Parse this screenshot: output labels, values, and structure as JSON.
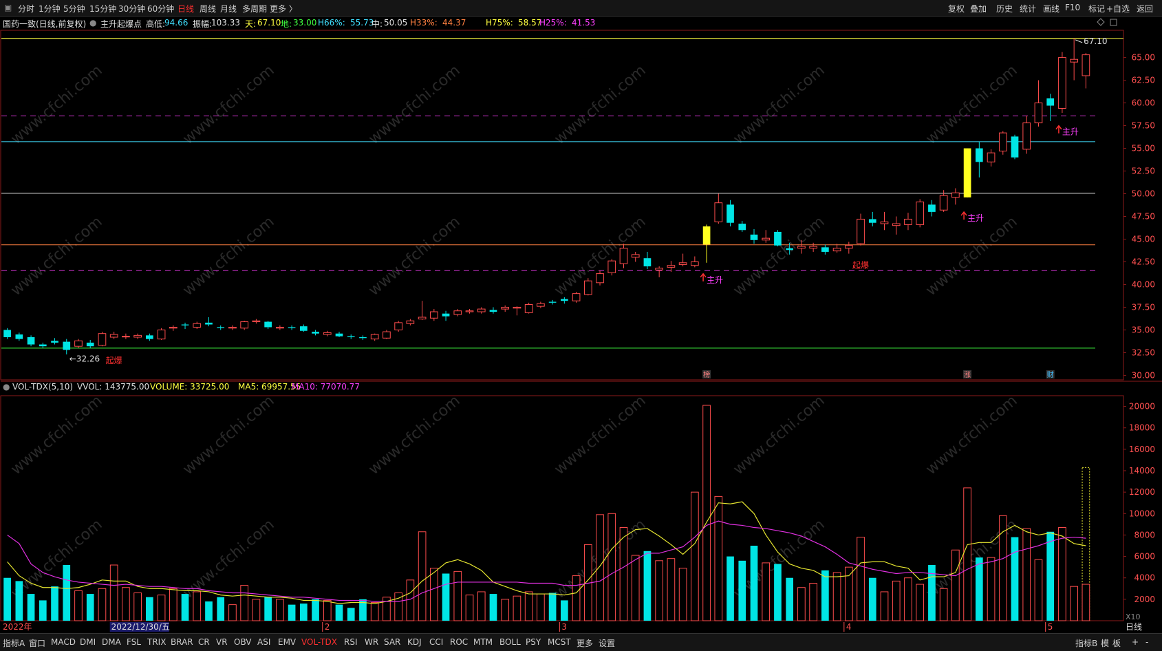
{
  "topbar": {
    "periods": [
      "分时",
      "1分钟",
      "5分钟",
      "15分钟",
      "30分钟",
      "60分钟",
      "日线",
      "周线",
      "月线",
      "多周期",
      "更多 〉"
    ],
    "active_period": "日线",
    "right_buttons": [
      "复权",
      "叠加",
      "历史",
      "统计",
      "画线",
      "F10",
      "标记",
      "+自选",
      "返回"
    ]
  },
  "infobar": {
    "stock": "国药一致(日线,前复权)",
    "indicator": "主升起爆点",
    "items": [
      {
        "label": "高低:",
        "value": "94.66",
        "color": "#e0e0e0",
        "vcolor": "#40e0ff"
      },
      {
        "label": "振幅:",
        "value": "103.33",
        "color": "#e0e0e0",
        "vcolor": "#e0e0e0"
      },
      {
        "label": "天:",
        "value": "67.10",
        "color": "#ffff40",
        "vcolor": "#ffff40"
      },
      {
        "label": "地:",
        "value": "33.00",
        "color": "#40ff40",
        "vcolor": "#40ff40"
      },
      {
        "label": "H66%:",
        "value": "55.73",
        "color": "#40e0ff",
        "vcolor": "#40e0ff"
      },
      {
        "label": "中:",
        "value": "50.05",
        "color": "#e0e0e0",
        "vcolor": "#e0e0e0"
      },
      {
        "label": "H33%:",
        "value": "44.37",
        "color": "#ff8040",
        "vcolor": "#ff8040"
      },
      {
        "label": "H75%:",
        "value": "58.57",
        "color": "#ffff40",
        "vcolor": "#ffff40"
      },
      {
        "label": "H25%:",
        "value": "41.53",
        "color": "#ff40ff",
        "vcolor": "#ff40ff"
      }
    ]
  },
  "volinfo": {
    "title": "VOL-TDX(5,10)",
    "vvol": "VVOL: 143775.00",
    "volume": "VOLUME: 33725.00",
    "ma5": "MA5: 69957.55",
    "ma10": "MA10: 77070.77"
  },
  "bottombar": {
    "tabs": [
      "指标A",
      "窗口",
      "MACD",
      "DMI",
      "DMA",
      "FSL",
      "TRIX",
      "BRAR",
      "CR",
      "VR",
      "OBV",
      "ASI",
      "EMV",
      "VOL-TDX",
      "RSI",
      "WR",
      "SAR",
      "KDJ",
      "CCI",
      "ROC",
      "MTM",
      "BOLL",
      "PSY",
      "MCST",
      "更多",
      "设置"
    ],
    "active_tab": "VOL-TDX",
    "right": [
      "指标B",
      "模",
      "板",
      "+",
      "-"
    ],
    "period_label": "日线"
  },
  "axis_labels": {
    "x_dates": [
      "2022年",
      "2022/12/30/五",
      "2",
      "3",
      "4",
      "5"
    ],
    "vol_unit": "X10"
  },
  "annotations": {
    "high_price": "67.10",
    "low_price": "32.26",
    "signals": [
      "起爆",
      "主升",
      "起爆",
      "主升",
      "主升"
    ],
    "tags": [
      "榜",
      "涨",
      "财"
    ]
  },
  "watermark": "www.cfchi.com",
  "chart_data": [
    {
      "type": "candlestick",
      "title": "国药一致(日线,前复权)",
      "ylim": [
        29.5,
        68.0
      ],
      "y_ticks": [
        30.0,
        32.5,
        35.0,
        37.5,
        40.0,
        42.5,
        45.0,
        47.5,
        50.0,
        52.5,
        55.0,
        57.5,
        60.0,
        62.5,
        65.0
      ],
      "levels": [
        {
          "name": "天",
          "value": 67.1,
          "color": "#ffff40",
          "style": "solid"
        },
        {
          "name": "H75%",
          "value": 58.57,
          "color": "#cc33cc",
          "style": "dashed"
        },
        {
          "name": "H66%",
          "value": 55.73,
          "color": "#40e0ff",
          "style": "solid"
        },
        {
          "name": "中",
          "value": 50.05,
          "color": "#e0e0e0",
          "style": "solid"
        },
        {
          "name": "H33%",
          "value": 44.37,
          "color": "#ff8040",
          "style": "solid"
        },
        {
          "name": "H25%",
          "value": 41.53,
          "color": "#cc33cc",
          "style": "dashed"
        },
        {
          "name": "地",
          "value": 33.0,
          "color": "#40ff40",
          "style": "solid"
        }
      ],
      "candles": [
        [
          35.0,
          34.2,
          35.2,
          34.0
        ],
        [
          34.5,
          34.0,
          34.7,
          33.8
        ],
        [
          34.2,
          33.4,
          34.4,
          33.2
        ],
        [
          33.4,
          33.2,
          33.6,
          33.0
        ],
        [
          33.8,
          33.6,
          34.1,
          33.4
        ],
        [
          33.7,
          32.8,
          34.0,
          32.3
        ],
        [
          33.2,
          33.8,
          34.0,
          33.0
        ],
        [
          33.6,
          33.2,
          33.9,
          33.0
        ],
        [
          33.3,
          34.6,
          34.8,
          33.2
        ],
        [
          34.2,
          34.5,
          34.8,
          34.0
        ],
        [
          34.3,
          34.3,
          34.6,
          34.0
        ],
        [
          34.2,
          34.4,
          34.6,
          34.0
        ],
        [
          34.4,
          34.0,
          34.6,
          33.8
        ],
        [
          34.0,
          35.0,
          35.2,
          33.9
        ],
        [
          35.2,
          35.3,
          35.5,
          34.9
        ],
        [
          35.6,
          35.5,
          35.8,
          35.1
        ],
        [
          35.3,
          35.7,
          35.9,
          35.1
        ],
        [
          35.8,
          35.6,
          36.4,
          35.4
        ],
        [
          35.3,
          35.2,
          35.5,
          35.0
        ],
        [
          35.2,
          35.3,
          35.5,
          35.0
        ],
        [
          35.2,
          35.9,
          36.0,
          35.0
        ],
        [
          35.9,
          36.0,
          36.2,
          35.7
        ],
        [
          35.9,
          35.3,
          36.0,
          35.1
        ],
        [
          35.2,
          35.3,
          35.5,
          35.0
        ],
        [
          35.3,
          35.2,
          35.5,
          35.0
        ],
        [
          35.4,
          34.9,
          35.6,
          34.8
        ],
        [
          34.8,
          34.6,
          35.0,
          34.4
        ],
        [
          34.5,
          34.7,
          34.9,
          34.3
        ],
        [
          34.6,
          34.3,
          34.8,
          34.2
        ],
        [
          34.3,
          34.2,
          34.5,
          34.0
        ],
        [
          34.2,
          34.1,
          34.4,
          33.9
        ],
        [
          34.0,
          34.5,
          34.6,
          33.8
        ],
        [
          34.1,
          34.8,
          35.0,
          34.0
        ],
        [
          35.0,
          35.8,
          36.0,
          34.8
        ],
        [
          35.7,
          36.0,
          36.2,
          35.5
        ],
        [
          36.2,
          36.4,
          38.2,
          36.1
        ],
        [
          36.3,
          37.0,
          37.3,
          36.0
        ],
        [
          36.8,
          36.5,
          37.1,
          36.0
        ],
        [
          36.7,
          37.1,
          37.3,
          36.5
        ],
        [
          37.0,
          37.1,
          37.3,
          36.8
        ],
        [
          37.0,
          37.3,
          37.5,
          36.8
        ],
        [
          37.2,
          37.0,
          37.5,
          36.8
        ],
        [
          37.3,
          37.5,
          37.7,
          37.0
        ],
        [
          37.4,
          37.5,
          37.6,
          36.6
        ],
        [
          36.9,
          37.8,
          38.0,
          36.8
        ],
        [
          37.6,
          37.9,
          38.1,
          37.4
        ],
        [
          38.1,
          38.0,
          38.3,
          37.8
        ],
        [
          38.4,
          38.2,
          38.6,
          37.9
        ],
        [
          38.2,
          39.0,
          39.2,
          38.0
        ],
        [
          38.9,
          40.4,
          40.7,
          38.8
        ],
        [
          40.2,
          41.2,
          41.5,
          39.9
        ],
        [
          41.3,
          42.6,
          42.8,
          41.0
        ],
        [
          42.3,
          44.0,
          44.5,
          41.8
        ],
        [
          43.0,
          43.3,
          43.6,
          42.5
        ],
        [
          42.9,
          42.0,
          43.6,
          41.7
        ],
        [
          41.6,
          41.8,
          42.0,
          40.8
        ],
        [
          41.9,
          42.1,
          42.6,
          41.4
        ],
        [
          42.2,
          42.4,
          43.4,
          42.0
        ],
        [
          42.1,
          42.5,
          43.1,
          41.9
        ],
        [
          44.4,
          46.4,
          46.6,
          42.4
        ],
        [
          46.9,
          49.0,
          50.0,
          46.7
        ],
        [
          48.8,
          46.8,
          49.3,
          46.4
        ],
        [
          46.7,
          46.0,
          47.0,
          45.8
        ],
        [
          45.5,
          44.9,
          46.1,
          44.5
        ],
        [
          44.9,
          45.1,
          46.0,
          44.6
        ],
        [
          45.8,
          44.3,
          46.0,
          44.2
        ],
        [
          44.0,
          43.8,
          44.6,
          43.3
        ],
        [
          44.0,
          44.2,
          44.9,
          43.4
        ],
        [
          44.0,
          44.2,
          44.6,
          43.6
        ],
        [
          44.1,
          43.6,
          44.4,
          43.3
        ],
        [
          43.7,
          44.0,
          44.5,
          43.5
        ],
        [
          44.0,
          44.3,
          44.7,
          43.4
        ],
        [
          44.5,
          47.2,
          47.8,
          44.3
        ],
        [
          47.2,
          46.8,
          48.0,
          46.4
        ],
        [
          46.7,
          46.9,
          48.0,
          46.0
        ],
        [
          46.5,
          46.7,
          47.5,
          45.5
        ],
        [
          46.6,
          47.2,
          47.9,
          46.0
        ],
        [
          46.6,
          49.1,
          49.4,
          46.3
        ],
        [
          48.8,
          48.0,
          49.3,
          47.5
        ],
        [
          48.2,
          49.8,
          50.4,
          48.0
        ],
        [
          49.6,
          50.1,
          50.6,
          48.8
        ],
        [
          49.6,
          55.0,
          55.0,
          49.6
        ],
        [
          55.0,
          53.5,
          55.7,
          51.8
        ],
        [
          53.5,
          54.5,
          54.9,
          53.0
        ],
        [
          54.7,
          56.7,
          56.9,
          54.3
        ],
        [
          56.3,
          54.0,
          56.5,
          53.8
        ],
        [
          54.9,
          57.8,
          58.6,
          54.4
        ],
        [
          57.8,
          60.0,
          62.5,
          57.4
        ],
        [
          60.5,
          59.7,
          61.0,
          58.0
        ],
        [
          59.4,
          65.0,
          65.6,
          58.9
        ],
        [
          64.5,
          64.8,
          67.1,
          62.5
        ],
        [
          63.0,
          65.3,
          65.5,
          61.6
        ]
      ],
      "signals": [
        {
          "index": 9,
          "text": "起爆",
          "price": 31.3
        },
        {
          "index": 59,
          "text": "主升",
          "price": 40.2
        },
        {
          "index": 72,
          "text": "起爆",
          "price": 41.8
        },
        {
          "index": 81,
          "text": "主升",
          "price": 47.0
        },
        {
          "index": 89,
          "text": "主升",
          "price": 56.5
        }
      ],
      "strong_days": [
        59,
        81
      ]
    },
    {
      "type": "bar",
      "title": "VOL-TDX(5,10)",
      "ylim": [
        0,
        21000
      ],
      "y_ticks": [
        2000,
        4000,
        6000,
        8000,
        10000,
        12000,
        14000,
        16000,
        18000,
        20000
      ],
      "series": [
        {
          "name": "VOLUME",
          "values": [
            4000,
            3700,
            2500,
            1900,
            3200,
            5200,
            2800,
            2500,
            3000,
            5200,
            3100,
            2600,
            2200,
            2400,
            3000,
            2500,
            2700,
            1800,
            2200,
            1500,
            3300,
            2000,
            2200,
            2000,
            1500,
            1600,
            2000,
            1900,
            1500,
            1200,
            2000,
            1700,
            2200,
            2600,
            3800,
            8300,
            4900,
            4400,
            4600,
            2400,
            2700,
            2500,
            2000,
            2300,
            2700,
            2500,
            2600,
            1900,
            4200,
            7100,
            9900,
            10000,
            8700,
            6100,
            6500,
            5600,
            5800,
            4900,
            12000,
            20100,
            11600,
            6000,
            5600,
            7000,
            5400,
            5300,
            4000,
            3100,
            3500,
            4700,
            4500,
            5000,
            7800,
            4000,
            2700,
            3700,
            4000,
            3400,
            5200,
            3000,
            6600,
            12400,
            5900,
            5900,
            9800,
            7800,
            8600,
            5700,
            8300,
            8700,
            3200,
            14300
          ]
        },
        {
          "name": "MA5",
          "values": [
            5500,
            4200,
            3500,
            3100,
            3100,
            3000,
            3100,
            3400,
            3800,
            3700,
            3700,
            3200,
            3000,
            3000,
            2900,
            2800,
            2800,
            2700,
            2400,
            2300,
            2400,
            2300,
            2200,
            2200,
            2100,
            1900,
            1900,
            1800,
            1600,
            1700,
            1700,
            1600,
            1800,
            2100,
            2600,
            3700,
            4500,
            5400,
            5700,
            5300,
            4700,
            3600,
            3200,
            2800,
            2500,
            2500,
            2500,
            2400,
            2600,
            3800,
            5100,
            6700,
            7800,
            8500,
            8600,
            7900,
            7100,
            6200,
            7200,
            9200,
            11000,
            10900,
            11100,
            10000,
            8000,
            6400,
            5300,
            4900,
            4700,
            4100,
            4100,
            4200,
            5400,
            5500,
            5500,
            5100,
            4900,
            3800,
            4100,
            4100,
            4500,
            7100,
            7300,
            7300,
            8300,
            8900,
            8300,
            8000,
            8200,
            7900,
            7200,
            7000
          ]
        },
        {
          "name": "MA10",
          "values": [
            8000,
            7200,
            5300,
            4500,
            4100,
            3800,
            3600,
            3500,
            3400,
            3300,
            3400,
            3300,
            3200,
            3200,
            3100,
            3000,
            3000,
            2800,
            2700,
            2600,
            2600,
            2500,
            2400,
            2300,
            2200,
            2200,
            2100,
            2000,
            1900,
            1900,
            1900,
            1800,
            1800,
            1800,
            2000,
            2600,
            3000,
            3400,
            3600,
            3600,
            3600,
            3600,
            3600,
            3600,
            3500,
            3500,
            3500,
            3300,
            3300,
            3500,
            3700,
            4400,
            5000,
            5700,
            6300,
            6300,
            6600,
            6900,
            7800,
            8900,
            9300,
            9000,
            8900,
            8700,
            8600,
            8400,
            8200,
            7900,
            7400,
            6900,
            6200,
            5400,
            5100,
            4800,
            4600,
            4400,
            4500,
            4500,
            4400,
            4300,
            4200,
            4800,
            5300,
            5500,
            5800,
            6400,
            6700,
            7000,
            7400,
            7700,
            7800,
            7700
          ]
        }
      ],
      "colors": {
        "up": "#ff4d4d",
        "down": "#00e5e5",
        "ma5": "#e5e530",
        "ma10": "#e030e0"
      },
      "last_bar_style": "dotted"
    }
  ]
}
